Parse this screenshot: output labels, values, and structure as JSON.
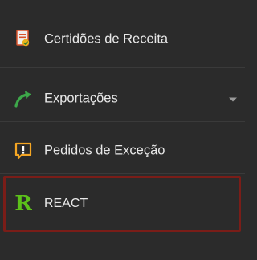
{
  "menu": {
    "items": [
      {
        "label": "Certidões de Receita",
        "icon": "certificate-document-icon"
      },
      {
        "label": "Exportações",
        "icon": "export-arrow-icon",
        "has_submenu": true
      },
      {
        "label": "Pedidos de Exceção",
        "icon": "exception-alert-icon"
      },
      {
        "label": "REACT",
        "icon": "react-logo-icon",
        "icon_glyph": "R",
        "highlighted": true
      }
    ]
  },
  "colors": {
    "background": "#2b2b2b",
    "text": "#e8e8e8",
    "highlight_border": "#7a1d18",
    "react_logo": "#5cc11a",
    "export_arrow": "#4caf50",
    "exception_icon": "#f5a623"
  }
}
